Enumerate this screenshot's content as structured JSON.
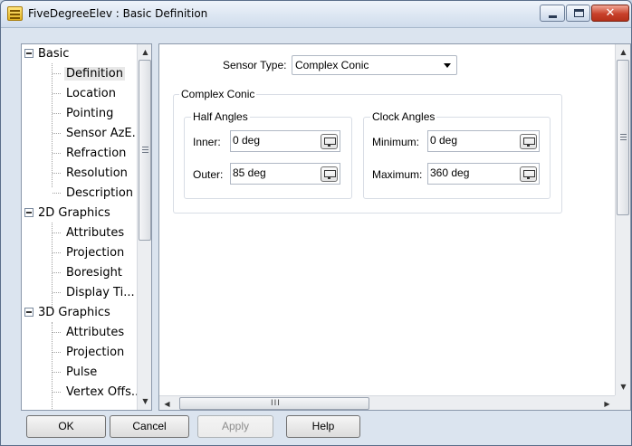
{
  "window": {
    "title": "FiveDegreeElev : Basic Definition",
    "close_glyph": "✕"
  },
  "tree": {
    "groups": [
      {
        "label": "Basic",
        "children": [
          "Definition",
          "Location",
          "Pointing",
          "Sensor AzE...",
          "Refraction",
          "Resolution",
          "Description"
        ]
      },
      {
        "label": "2D Graphics",
        "children": [
          "Attributes",
          "Projection",
          "Boresight",
          "Display Ti..."
        ]
      },
      {
        "label": "3D Graphics",
        "children": [
          "Attributes",
          "Projection",
          "Pulse",
          "Vertex Offs..."
        ]
      }
    ],
    "selected": "Definition"
  },
  "main": {
    "sensor_type_label": "Sensor Type:",
    "sensor_type_value": "Complex Conic",
    "complex_conic_title": "Complex Conic",
    "half_angles": {
      "title": "Half Angles",
      "inner_label": "Inner:",
      "inner_value": "0 deg",
      "outer_label": "Outer:",
      "outer_value": "85 deg"
    },
    "clock_angles": {
      "title": "Clock Angles",
      "minimum_label": "Minimum:",
      "minimum_value": "0 deg",
      "maximum_label": "Maximum:",
      "maximum_value": "360 deg"
    },
    "hscroll_grip": "III"
  },
  "buttons": {
    "ok": "OK",
    "cancel": "Cancel",
    "apply": "Apply",
    "help": "Help"
  },
  "icons": {
    "app": "sensor-properties-icon",
    "unit": "unit-selector-icon"
  }
}
